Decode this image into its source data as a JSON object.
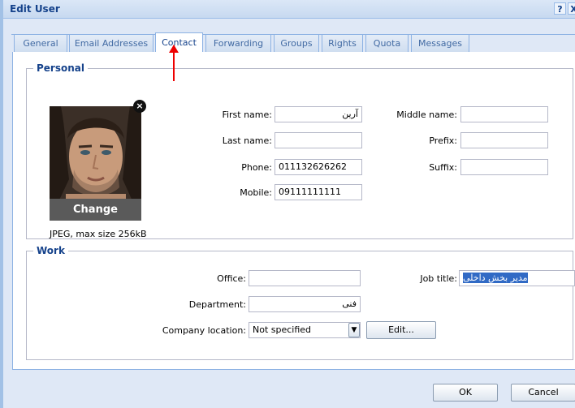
{
  "window": {
    "title": "Edit User",
    "help_label": "?",
    "close_label": "X"
  },
  "tabs": [
    "General",
    "Email Addresses",
    "Contact",
    "Forwarding",
    "Groups",
    "Rights",
    "Quota",
    "Messages"
  ],
  "personal": {
    "legend": "Personal",
    "photo": {
      "change_label": "Change",
      "remove_label": "×",
      "hint": "JPEG, max size 256kB"
    },
    "first_name": {
      "label": "First name:",
      "value": "آرین"
    },
    "last_name": {
      "label": "Last name:",
      "value": ""
    },
    "phone": {
      "label": "Phone:",
      "value": "011132626262"
    },
    "mobile": {
      "label": "Mobile:",
      "value": "09111111111"
    },
    "middle_name": {
      "label": "Middle name:",
      "value": ""
    },
    "prefix": {
      "label": "Prefix:",
      "value": ""
    },
    "suffix": {
      "label": "Suffix:",
      "value": ""
    }
  },
  "work": {
    "legend": "Work",
    "office": {
      "label": "Office:",
      "value": ""
    },
    "department": {
      "label": "Department:",
      "value": "فنی"
    },
    "company_location": {
      "label": "Company location:",
      "value": "Not specified",
      "edit_label": "Edit..."
    },
    "job_title": {
      "label": "Job title:",
      "value": "مدیر بخش داخلی"
    }
  },
  "footer": {
    "ok_label": "OK",
    "cancel_label": "Cancel"
  },
  "colors": {
    "accent": "#15428b",
    "annotation_arrow": "#ee0000",
    "selection": "#316ac5"
  }
}
